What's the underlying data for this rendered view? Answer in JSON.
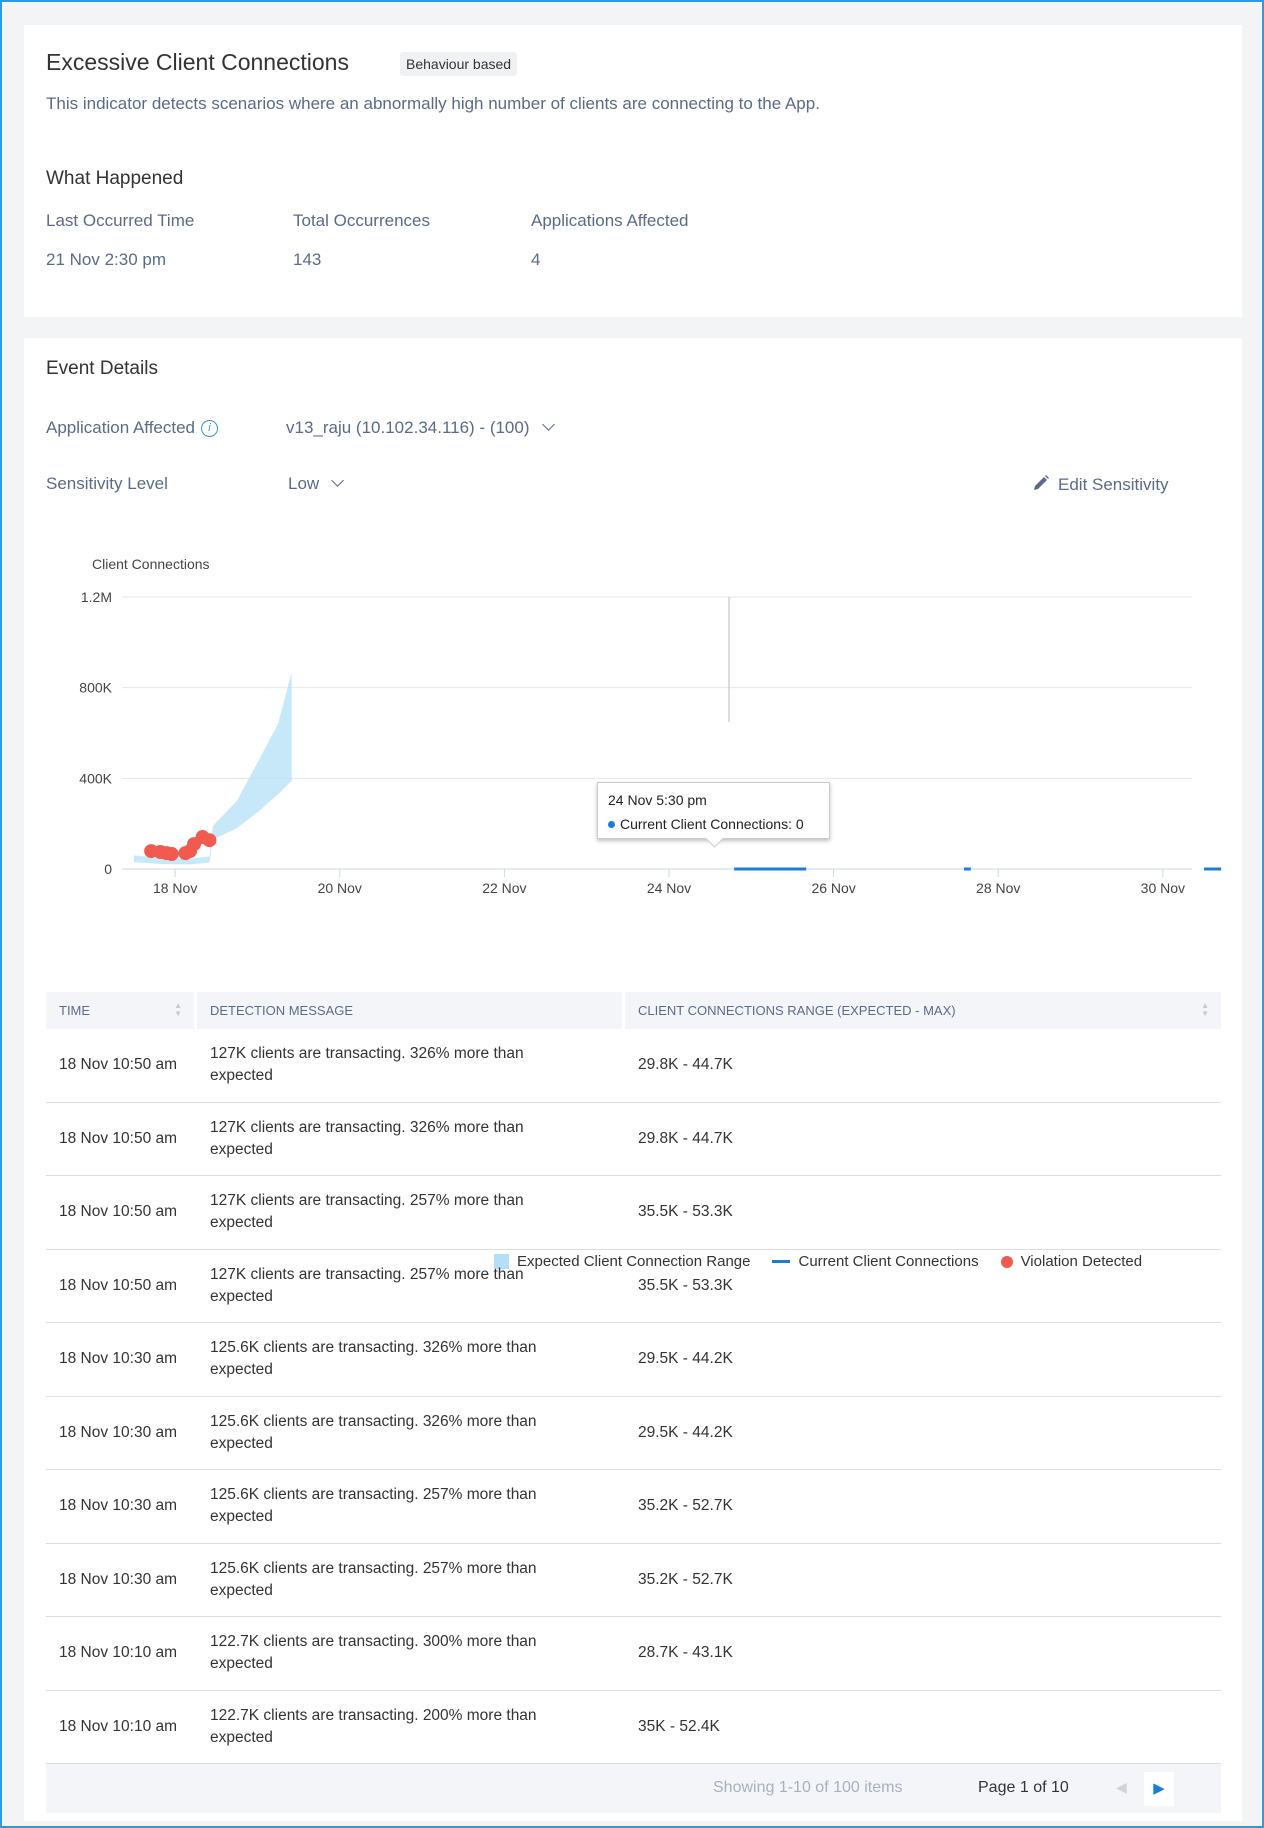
{
  "header": {
    "title": "Excessive Client Connections",
    "badge": "Behaviour based",
    "description": "This indicator detects scenarios where an abnormally high number of clients are connecting to the App."
  },
  "what_happened": {
    "title": "What Happened",
    "stats": [
      {
        "label": "Last Occurred Time",
        "value": "21 Nov 2:30 pm"
      },
      {
        "label": "Total Occurrences",
        "value": "143"
      },
      {
        "label": "Applications Affected",
        "value": "4"
      }
    ]
  },
  "event_details": {
    "title": "Event Details",
    "app_label": "Application Affected",
    "app_value": "v13_raju (10.102.34.116) - (100)",
    "sensitivity_label": "Sensitivity Level",
    "sensitivity_value": "Low",
    "edit_label": "Edit Sensitivity"
  },
  "colors": {
    "band": "#b3e0f7",
    "line": "#1a7fd4",
    "violation": "#f05a4f",
    "border": "#2a9be6"
  },
  "chart_data": {
    "type": "line",
    "ylabel": "Client Connections",
    "ylim": [
      0,
      1200000
    ],
    "yticks": [
      {
        "v": 0,
        "label": "0"
      },
      {
        "v": 400000,
        "label": "400K"
      },
      {
        "v": 800000,
        "label": "800K"
      },
      {
        "v": 1200000,
        "label": "1.2M"
      }
    ],
    "xlim": [
      "2023-11-17T08:30",
      "2023-11-30T08:30"
    ],
    "xticks": [
      {
        "d": "2023-11-18",
        "label": "18 Nov"
      },
      {
        "d": "2023-11-20",
        "label": "20 Nov"
      },
      {
        "d": "2023-11-22",
        "label": "22 Nov"
      },
      {
        "d": "2023-11-24",
        "label": "24 Nov"
      },
      {
        "d": "2023-11-26",
        "label": "26 Nov"
      },
      {
        "d": "2023-11-28",
        "label": "28 Nov"
      },
      {
        "d": "2023-11-30",
        "label": "30 Nov"
      }
    ],
    "series": [
      {
        "name": "Expected Client Connection Range",
        "kind": "band",
        "points": [
          [
            "2023-11-17T12:00",
            30000,
            60000
          ],
          [
            "2023-11-17T20:00",
            22000,
            48000
          ],
          [
            "2023-11-18T04:00",
            20000,
            45000
          ],
          [
            "2023-11-18T10:00",
            28000,
            55000
          ],
          [
            "2023-11-18T11:00",
            130000,
            190000
          ],
          [
            "2023-11-18T18:00",
            180000,
            300000
          ],
          [
            "2023-11-19T00:00",
            250000,
            470000
          ],
          [
            "2023-11-19T06:00",
            330000,
            640000
          ],
          [
            "2023-11-19T10:00",
            390000,
            870000
          ]
        ]
      },
      {
        "name": "Current Client Connections",
        "kind": "line",
        "segments": [
          [
            [
              "2023-11-24T19:00",
              0
            ],
            [
              "2023-11-25T16:00",
              0
            ]
          ],
          [
            [
              "2023-11-27T14:00",
              0
            ],
            [
              "2023-11-27T16:00",
              0
            ]
          ],
          [
            [
              "2023-11-30T12:00",
              0
            ],
            [
              "2023-11-30T17:00",
              0
            ]
          ]
        ]
      },
      {
        "name": "Violation Detected",
        "kind": "scatter",
        "points": [
          [
            "2023-11-17T17:00",
            79000
          ],
          [
            "2023-11-17T19:40",
            75000
          ],
          [
            "2023-11-17T21:30",
            70000
          ],
          [
            "2023-11-17T23:00",
            66000
          ],
          [
            "2023-11-18T03:00",
            70000
          ],
          [
            "2023-11-18T04:20",
            79000
          ],
          [
            "2023-11-18T05:30",
            110000
          ],
          [
            "2023-11-18T08:00",
            141000
          ],
          [
            "2023-11-18T10:00",
            127000
          ]
        ]
      }
    ],
    "tooltip": {
      "time": "24 Nov 5:30 pm",
      "label": "Current Client Connections: 0",
      "at": "2023-11-24T17:30"
    },
    "legend_placement": "bottom-right"
  },
  "table": {
    "columns": [
      "TIME",
      "DETECTION MESSAGE",
      "CLIENT CONNECTIONS RANGE (EXPECTED - MAX)"
    ],
    "rows": [
      [
        "18 Nov 10:50 am",
        "127K clients are transacting. 326% more than expected",
        "29.8K - 44.7K"
      ],
      [
        "18 Nov 10:50 am",
        "127K clients are transacting. 326% more than expected",
        "29.8K - 44.7K"
      ],
      [
        "18 Nov 10:50 am",
        "127K clients are transacting. 257% more than expected",
        "35.5K - 53.3K"
      ],
      [
        "18 Nov 10:50 am",
        "127K clients are transacting. 257% more than expected",
        "35.5K - 53.3K"
      ],
      [
        "18 Nov 10:30 am",
        "125.6K clients are transacting. 326% more than expected",
        "29.5K - 44.2K"
      ],
      [
        "18 Nov 10:30 am",
        "125.6K clients are transacting. 326% more than expected",
        "29.5K - 44.2K"
      ],
      [
        "18 Nov 10:30 am",
        "125.6K clients are transacting. 257% more than expected",
        "35.2K - 52.7K"
      ],
      [
        "18 Nov 10:30 am",
        "125.6K clients are transacting. 257% more than expected",
        "35.2K - 52.7K"
      ],
      [
        "18 Nov 10:10 am",
        "122.7K clients are transacting. 300% more than expected",
        "28.7K - 43.1K"
      ],
      [
        "18 Nov 10:10 am",
        "122.7K clients are transacting. 200% more than expected",
        "35K - 52.4K"
      ]
    ]
  },
  "pagination": {
    "showing": "Showing 1-10 of 100 items",
    "page_prefix": "Page",
    "page": "1",
    "page_of": "of 10"
  }
}
